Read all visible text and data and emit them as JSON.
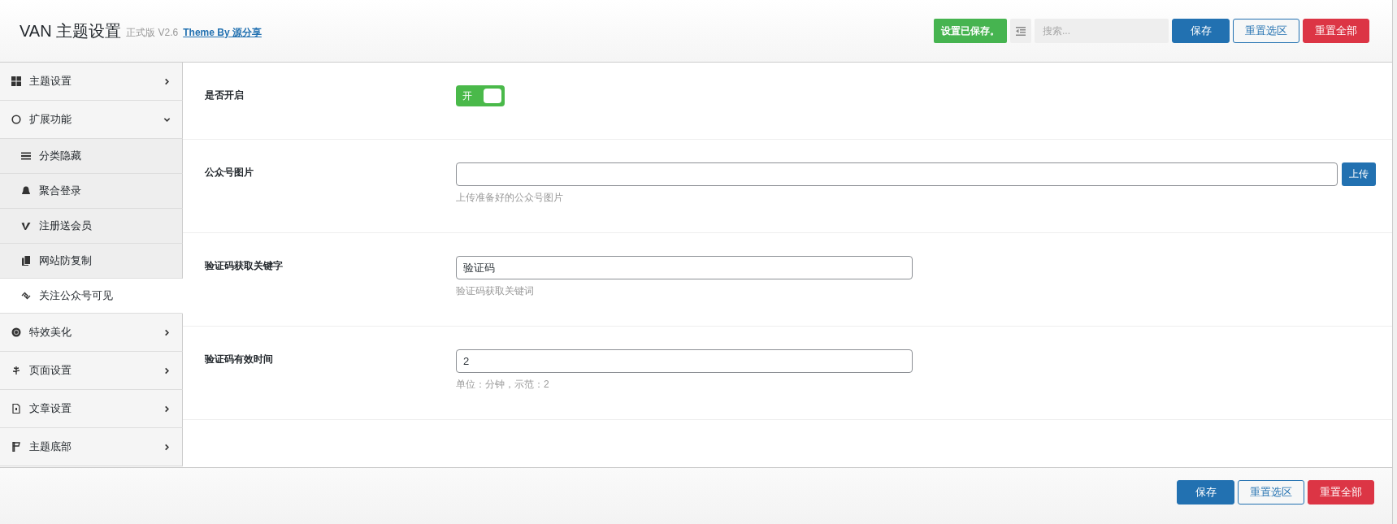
{
  "header": {
    "title": "VAN 主题设置",
    "version": "正式版 V2.6",
    "link": "Theme By 源分享",
    "status": "设置已保存。",
    "search": {
      "placeholder": "搜索..."
    },
    "buttons": [
      {
        "label": "保存",
        "kind": "primary"
      },
      {
        "label": "重置选区",
        "kind": "outline"
      },
      {
        "label": "重置全部",
        "kind": "danger"
      }
    ]
  },
  "sidebar": {
    "items": [
      {
        "label": "主题设置",
        "expanded": false
      },
      {
        "label": "扩展功能",
        "expanded": true,
        "children": [
          {
            "label": "分类隐藏",
            "selected": false
          },
          {
            "label": "聚合登录",
            "selected": false
          },
          {
            "label": "注册送会员",
            "selected": false
          },
          {
            "label": "网站防复制",
            "selected": false
          },
          {
            "label": "关注公众号可见",
            "selected": true
          }
        ]
      },
      {
        "label": "特效美化",
        "expanded": false
      },
      {
        "label": "页面设置",
        "expanded": false
      },
      {
        "label": "文章设置",
        "expanded": false
      },
      {
        "label": "主题底部",
        "expanded": false
      }
    ]
  },
  "fields": [
    {
      "kind": "switch",
      "label": "是否开启",
      "on": true,
      "on_label": "开"
    },
    {
      "kind": "upload",
      "label": "公众号图片",
      "button": "上传",
      "description": "上传准备好的公众号图片"
    },
    {
      "kind": "text",
      "label": "验证码获取关键字",
      "value": "验证码",
      "description": "验证码获取关键词"
    },
    {
      "kind": "text",
      "label": "验证码有效时间",
      "value": "2",
      "description": "单位：分钟，示范：2"
    }
  ],
  "footer": {
    "buttons": [
      {
        "label": "保存",
        "kind": "primary"
      },
      {
        "label": "重置选区",
        "kind": "outline"
      },
      {
        "label": "重置全部",
        "kind": "danger"
      }
    ]
  }
}
